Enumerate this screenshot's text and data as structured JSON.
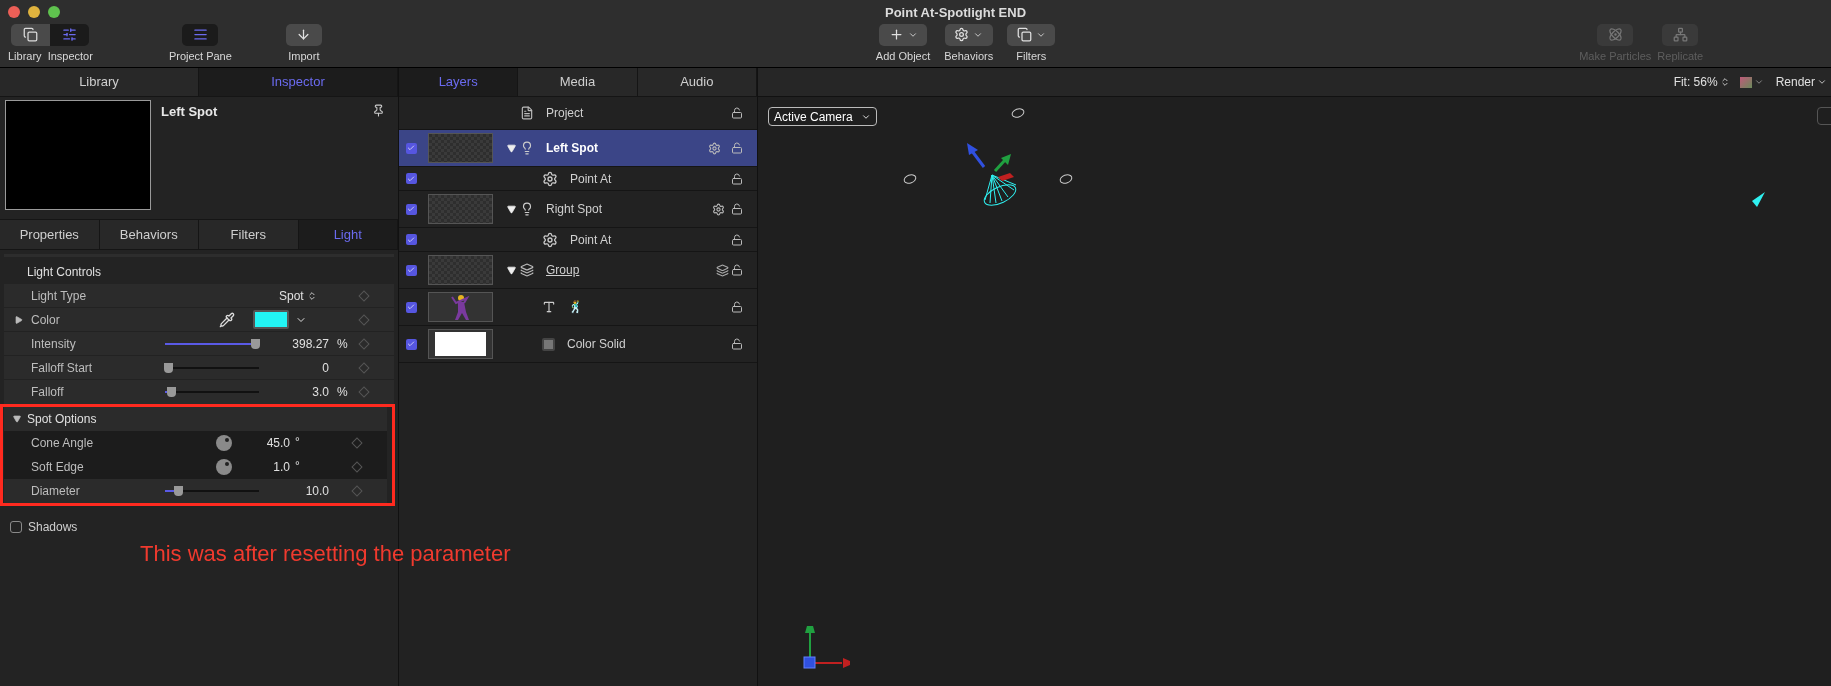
{
  "window": {
    "title": "Point At-Spotlight END"
  },
  "toolbar_left": [
    {
      "label": "Library",
      "selected": false
    },
    {
      "label": "Inspector",
      "selected": true
    }
  ],
  "toolbar_mid": [
    {
      "label": "Project Pane",
      "selected": true
    },
    {
      "label": "Import",
      "selected": false
    }
  ],
  "toolbar_center": [
    {
      "label": "Add Object"
    },
    {
      "label": "Behaviors"
    },
    {
      "label": "Filters"
    }
  ],
  "toolbar_right": [
    {
      "label": "Make Particles",
      "disabled": true
    },
    {
      "label": "Replicate",
      "disabled": true
    }
  ],
  "left_tabs": [
    {
      "label": "Library",
      "selected": false
    },
    {
      "label": "Inspector",
      "selected": true
    }
  ],
  "inspector": {
    "title": "Left Spot",
    "tabs": [
      {
        "label": "Properties",
        "selected": false
      },
      {
        "label": "Behaviors",
        "selected": false
      },
      {
        "label": "Filters",
        "selected": false
      },
      {
        "label": "Light",
        "selected": true
      }
    ],
    "section_title": "Light Controls",
    "params": [
      {
        "kind": "popup",
        "label": "Light Type",
        "value": "Spot"
      },
      {
        "kind": "color",
        "label": "Color",
        "color": "#22f4f4",
        "expanded": false
      },
      {
        "kind": "slider",
        "label": "Intensity",
        "level": 0.96,
        "value": "398.27",
        "unit": "%"
      },
      {
        "kind": "slider",
        "label": "Falloff Start",
        "level": 0.03,
        "value": "0"
      },
      {
        "kind": "slider",
        "label": "Falloff",
        "level": 0.06,
        "value": "3.0",
        "unit": "%"
      }
    ],
    "spot_options": {
      "title": "Spot Options",
      "expanded": true,
      "params": [
        {
          "kind": "dial",
          "label": "Cone Angle",
          "value": "45.0",
          "unit": "°"
        },
        {
          "kind": "dial",
          "label": "Soft Edge",
          "value": "1.0",
          "unit": "°"
        },
        {
          "kind": "slider",
          "label": "Diameter",
          "level": 0.14,
          "value": "10.0"
        }
      ]
    },
    "shadows": {
      "label": "Shadows",
      "checked": false
    }
  },
  "annotation": "This was after resetting the parameter",
  "layer_tabs": [
    {
      "label": "Layers",
      "selected": true
    },
    {
      "label": "Media",
      "selected": false
    },
    {
      "label": "Audio",
      "selected": false
    }
  ],
  "layers": [
    {
      "kind": "project",
      "name": "Project"
    },
    {
      "kind": "light",
      "name": "Left Spot",
      "checked": true,
      "selected": true,
      "children": [
        {
          "kind": "behavior",
          "name": "Point At",
          "checked": true,
          "selected": false
        }
      ]
    },
    {
      "kind": "light",
      "name": "Right Spot",
      "checked": true,
      "selected": false,
      "children": [
        {
          "kind": "behavior",
          "name": "Point At",
          "checked": true,
          "selected": false
        }
      ]
    },
    {
      "kind": "group",
      "name": "Group",
      "checked": true,
      "selected": false,
      "children": [
        {
          "kind": "text",
          "name": "🕺",
          "checked": true,
          "selected": false
        },
        {
          "kind": "solid",
          "name": "Color Solid",
          "checked": true,
          "selected": false
        }
      ]
    }
  ],
  "viewer": {
    "fit": "Fit: 56%",
    "render": "Render",
    "camera": "Active Camera"
  }
}
